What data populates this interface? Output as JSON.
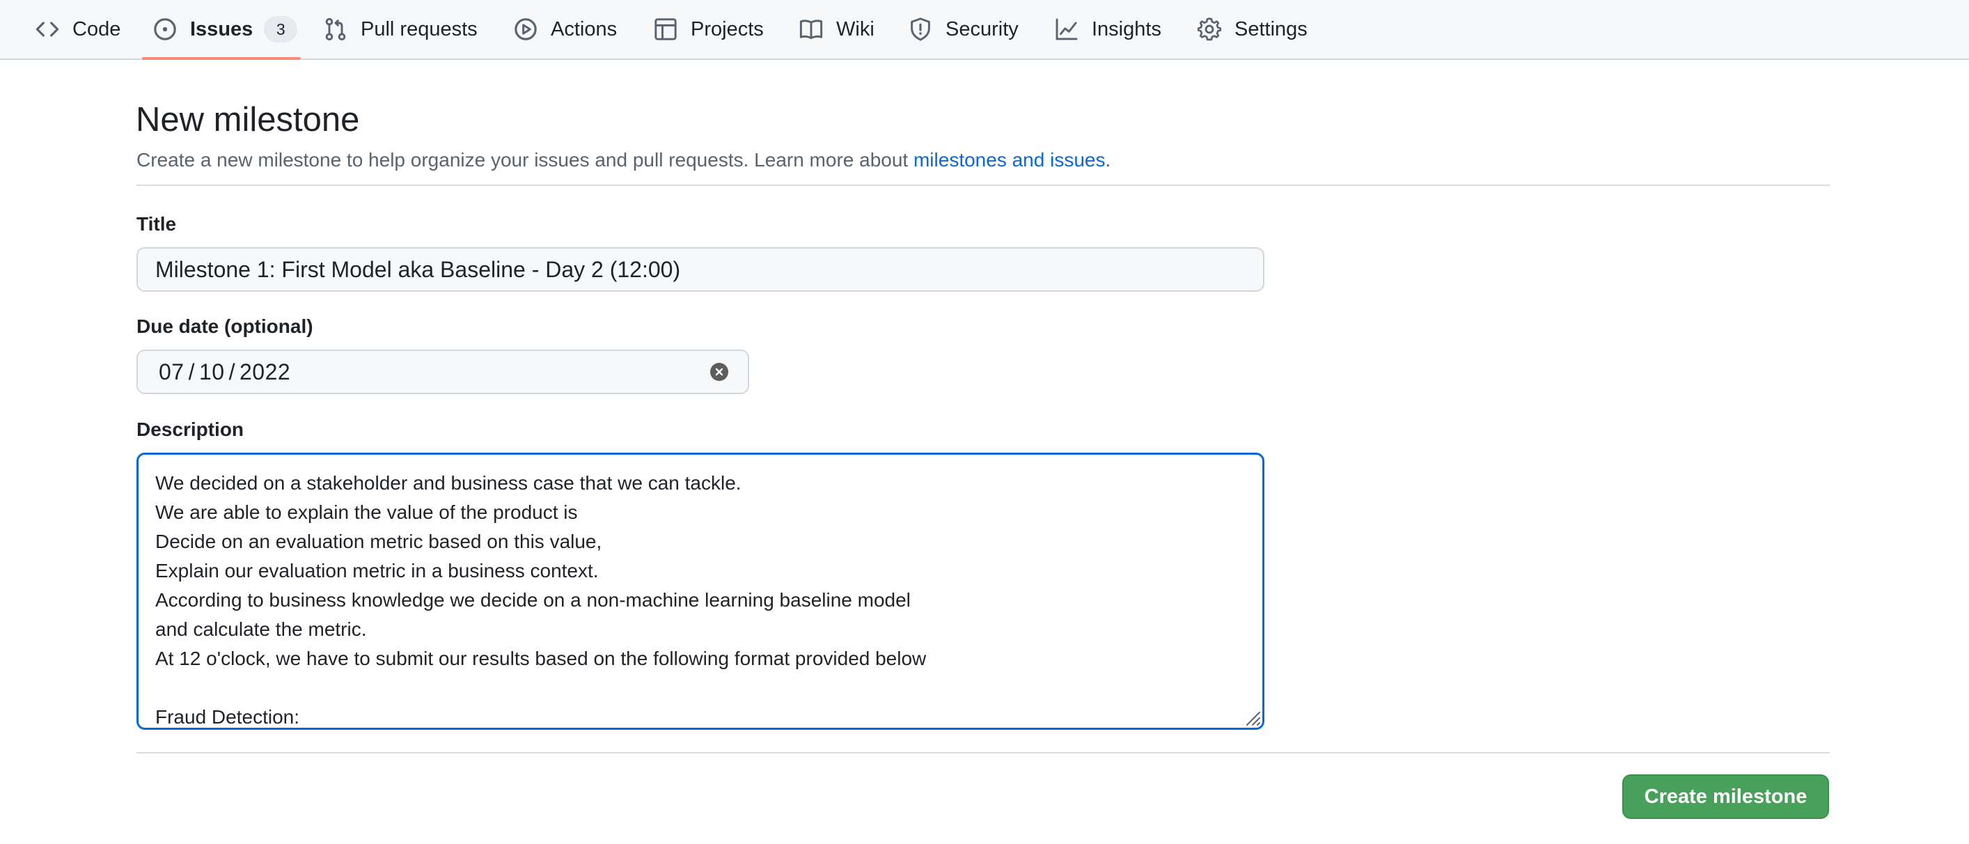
{
  "nav": {
    "tabs": [
      {
        "label": "Code",
        "icon": "code-icon"
      },
      {
        "label": "Issues",
        "icon": "issue-opened-icon",
        "count": "3",
        "selected": true
      },
      {
        "label": "Pull requests",
        "icon": "git-pull-request-icon"
      },
      {
        "label": "Actions",
        "icon": "play-icon"
      },
      {
        "label": "Projects",
        "icon": "table-icon"
      },
      {
        "label": "Wiki",
        "icon": "book-icon"
      },
      {
        "label": "Security",
        "icon": "shield-icon"
      },
      {
        "label": "Insights",
        "icon": "graph-icon"
      },
      {
        "label": "Settings",
        "icon": "gear-icon"
      }
    ],
    "selected_underline_color": "#fd8c73"
  },
  "page": {
    "title": "New milestone",
    "subtitle_text": "Create a new milestone to help organize your issues and pull requests. Learn more about ",
    "subtitle_link": "milestones and issues",
    "subtitle_end": "."
  },
  "form": {
    "title_label": "Title",
    "title_value": "Milestone 1: First Model aka Baseline - Day 2 (12:00)",
    "due_label": "Due date (optional)",
    "due_month": "07",
    "due_day": "10",
    "due_year": "2022",
    "due_separator": "/",
    "description_label": "Description",
    "description_lines": [
      "We decided on a stakeholder and business case that we can tackle.",
      "We are able to explain the value of the product is",
      "Decide on an evaluation metric based on this value,",
      "Explain our evaluation metric in a business context.",
      "According to business knowledge we decide on a non-machine learning baseline model",
      "and calculate the metric.",
      "At 12 o'clock, we have to submit our results based on the following format provided below",
      "",
      "Fraud Detection:"
    ]
  },
  "actions": {
    "create_label": "Create milestone",
    "create_color": "#47a15a"
  },
  "colors": {
    "link": "#0969da",
    "focus_border": "#0969da"
  }
}
